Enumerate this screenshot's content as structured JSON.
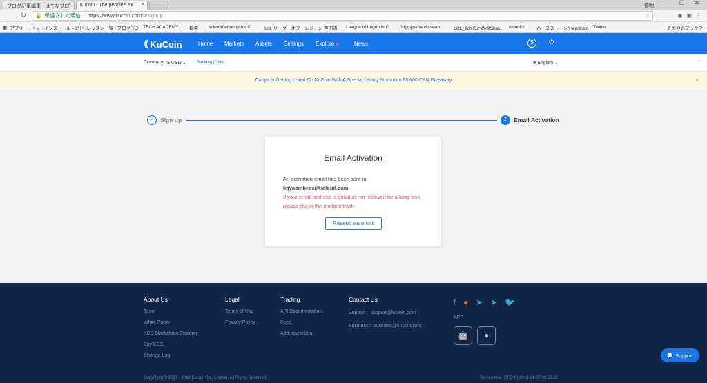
{
  "browser": {
    "tabs": [
      {
        "title": "ブログ記事編集 - はてなブロ",
        "close": "×"
      },
      {
        "title": "Kucoin - The people's ex",
        "close": "×"
      }
    ],
    "window_user": "修明",
    "address": {
      "secure_label": "保護された通信",
      "url_host": "https://www.kucoin.com",
      "url_path": "/#/signup"
    },
    "bookmarks": [
      "アプリ",
      "ドットインストール - 3分でわ",
      "レッスン一覧 | プログラミ",
      "TECH ACADEMY",
      "投資",
      "sokorahennnojan's C",
      "LoL リーグ・オブ・レジェン",
      "芦田道",
      "League of Legends C",
      "opgg-jp-match-searc",
      "LOL_2chまとめ@Shac",
      "niconico",
      "ハースストーン(Hearthsto",
      "Twitter"
    ],
    "other_bookmarks": "その他のブックマーク"
  },
  "header": {
    "logo": "KuCoin",
    "menu": [
      "Home",
      "Markets",
      "Assets",
      "Settings",
      "Explore",
      "News"
    ],
    "currency_label": "Currency :",
    "currency_value": "$ USD",
    "ranking": "Ranking (CAN)",
    "language": "English"
  },
  "notice": {
    "text": "Canya Is Getting Listed On KuCoin With A Special Listing Promotion 80,000 CAN Giveaway"
  },
  "steps": {
    "step1": "Sign up",
    "step2_num": "2",
    "step2": "Email Activation"
  },
  "card": {
    "title": "Email Activation",
    "line1": "An activation email has been sent to",
    "email": "kgyaomheesi@icloud.com",
    "email_suffix": ".",
    "warning": "If your email address is gmail or not received for a long time, please check the mailbox trash.",
    "button": "Resend an email"
  },
  "footer": {
    "about": {
      "title": "About Us",
      "items": [
        "Team",
        "White Paper",
        "KCS Blockchain Explorer",
        "Buy KCS",
        "Change Log"
      ]
    },
    "legal": {
      "title": "Legal",
      "items": [
        "Terms of Use",
        "Privacy Policy"
      ]
    },
    "trading": {
      "title": "Trading",
      "items": [
        "API Documentation",
        "Fees",
        "Add new token"
      ]
    },
    "contact": {
      "title": "Contact Us",
      "support": "Support：support@kucoin.com",
      "business": "Business：business@kucoin.com"
    },
    "app_label": "APP",
    "copyright": "CopyRight © 2017 - 2018 Kucoin Co., Limited. All Rights Reserved.",
    "server_time": "Server time (UTC+8) 2018-01-07 09:56:32",
    "support_button": "Support"
  }
}
